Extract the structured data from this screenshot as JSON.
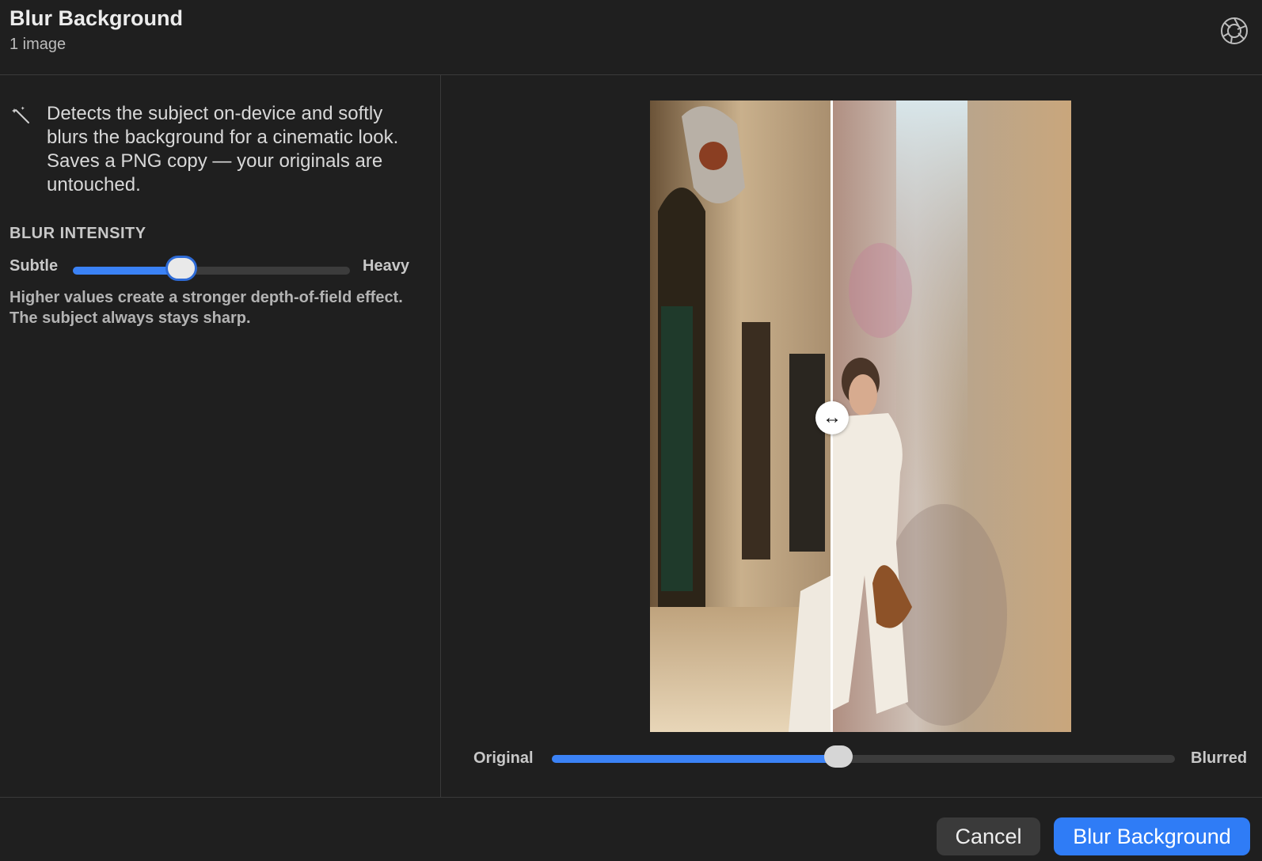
{
  "header": {
    "title": "Blur Background",
    "subtitle": "1 image",
    "icon": "aperture-icon"
  },
  "sidebar": {
    "description": "Detects the subject on-device and softly blurs the background for a cinematic look. Saves a PNG copy — your originals are untouched.",
    "description_icon": "magic-wand-icon",
    "intensity": {
      "label": "BLUR INTENSITY",
      "min_label": "Subtle",
      "max_label": "Heavy",
      "value": 0.39,
      "help": "Higher values create a stronger depth-of-field effect. The subject always stays sharp."
    }
  },
  "preview": {
    "image_description": "Woman in white outfit with brown handbag on sunlit stone street",
    "compare": {
      "left_label": "Original",
      "right_label": "Blurred",
      "value": 0.46
    },
    "handle_icon": "left-right-arrow-icon"
  },
  "footer": {
    "cancel_label": "Cancel",
    "primary_label": "Blur Background"
  },
  "colors": {
    "background": "#1f1f1f",
    "accent": "#3b82f6",
    "primary_button": "#2f7cf6"
  }
}
